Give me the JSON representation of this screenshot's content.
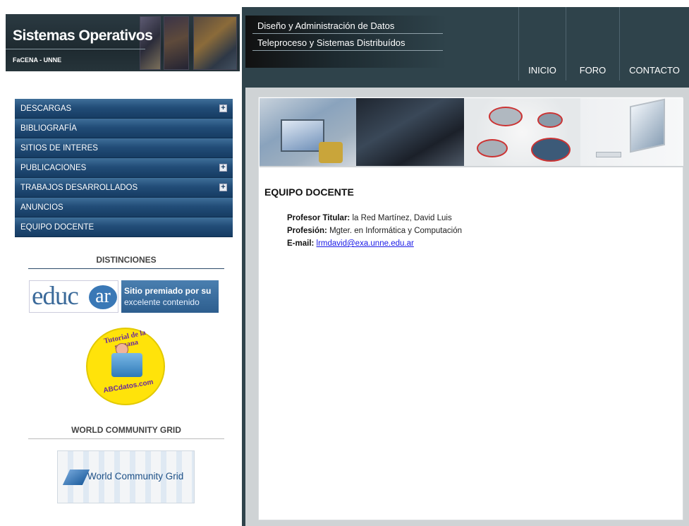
{
  "header": {
    "site_title": "Sistemas Operativos",
    "site_subtitle": "FaCENA - UNNE",
    "course_links": [
      "Diseño y Administración de Datos",
      "Teleproceso y Sistemas Distribuídos"
    ],
    "nav": [
      "INICIO",
      "FORO",
      "CONTACTO"
    ]
  },
  "sidebar": {
    "menu": [
      {
        "label": "DESCARGAS",
        "expandable": true
      },
      {
        "label": "BIBLIOGRAFÍA",
        "expandable": false
      },
      {
        "label": "SITIOS DE INTERES",
        "expandable": false
      },
      {
        "label": "PUBLICACIONES",
        "expandable": true
      },
      {
        "label": "TRABAJOS DESARROLLADOS",
        "expandable": true
      },
      {
        "label": "ANUNCIOS",
        "expandable": false
      },
      {
        "label": "EQUIPO DOCENTE",
        "expandable": false
      }
    ],
    "plus_glyph": "+",
    "distinciones": {
      "title": "DISTINCIONES",
      "educar_word": "educ",
      "educar_ar": "ar",
      "educar_banner_line1": "Sitio premiado por su",
      "educar_banner_line2": "excelente contenido",
      "tutorial_arc": "Tutorial de la semana",
      "tutorial_site": "ABCdatos.com"
    },
    "wcg": {
      "title": "WORLD COMMUNITY GRID",
      "logo_text": "World Community Grid"
    }
  },
  "main": {
    "page_title": "EQUIPO DOCENTE",
    "profesor_label": "Profesor Titular:",
    "profesor_value": " la Red Martínez, David Luis",
    "profesion_label": "Profesión:",
    "profesion_value": " Mgter. en Informática y Computación",
    "email_label": "E-mail:",
    "email_value": "lrmdavid@exa.unne.edu.ar"
  },
  "colors": {
    "header_bg": "#2f434b",
    "menu_blue": "#224d78",
    "link_blue": "#1a1ae6"
  }
}
